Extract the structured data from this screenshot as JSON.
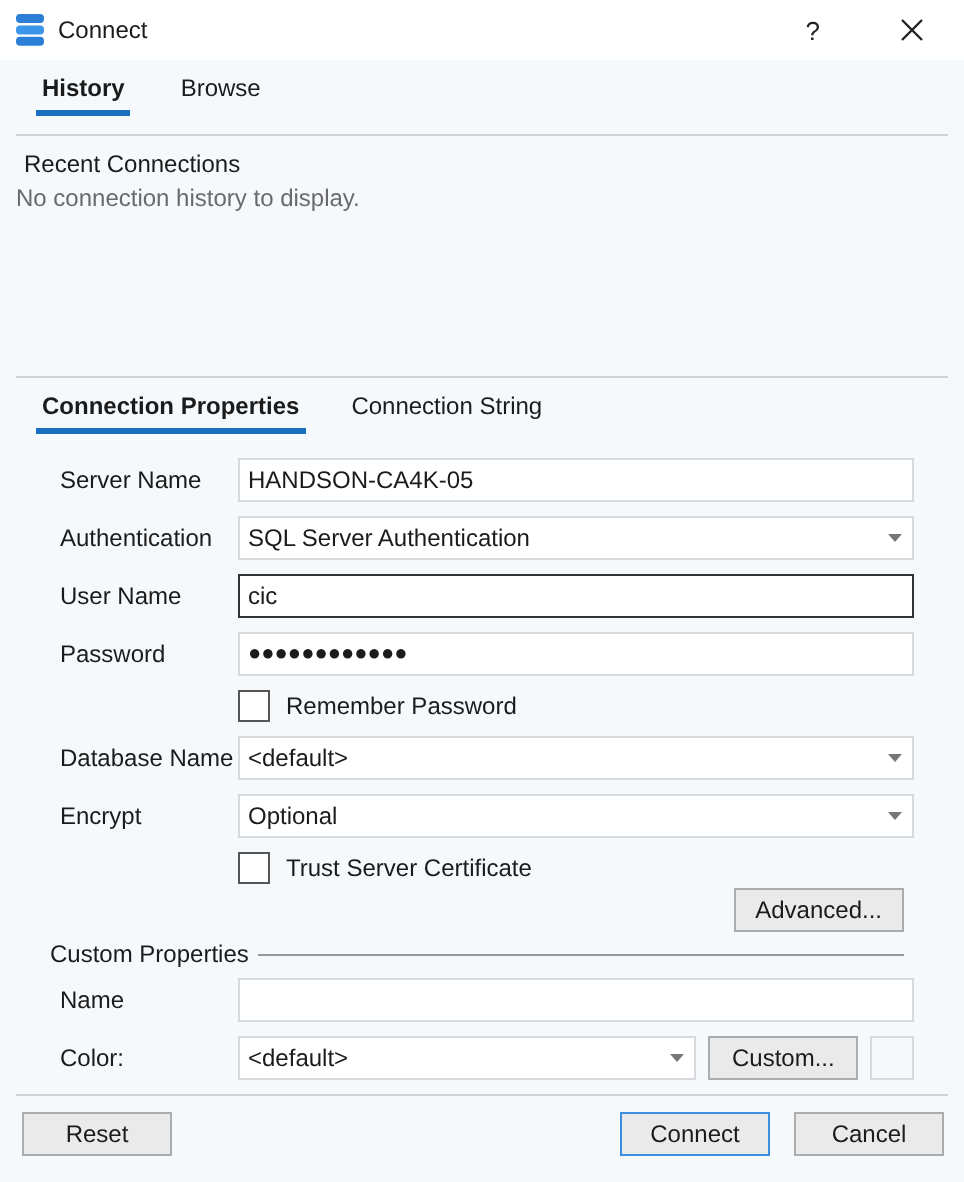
{
  "window": {
    "title": "Connect",
    "help": "?"
  },
  "top_tabs": [
    {
      "label": "History",
      "selected": true
    },
    {
      "label": "Browse",
      "selected": false
    }
  ],
  "recent": {
    "title": "Recent Connections",
    "message": "No connection history to display."
  },
  "property_tabs": [
    {
      "label": "Connection Properties",
      "selected": true
    },
    {
      "label": "Connection String",
      "selected": false
    }
  ],
  "fields": [
    {
      "kind": "text",
      "label": "Server Name",
      "value": "HANDSON-CA4K-05",
      "focused": false
    },
    {
      "kind": "dropdown",
      "label": "Authentication",
      "value": "SQL Server Authentication",
      "focused": false
    },
    {
      "kind": "text",
      "label": "User Name",
      "value": "cic",
      "focused": true
    },
    {
      "kind": "password",
      "label": "Password",
      "value": "●●●●●●●●●●●●",
      "focused": false
    },
    {
      "kind": "checkbox",
      "label": "Remember Password",
      "checked": false
    },
    {
      "kind": "dropdown",
      "label": "Database Name",
      "value": "<default>",
      "focused": false
    },
    {
      "kind": "dropdown",
      "label": "Encrypt",
      "value": "Optional",
      "focused": false
    },
    {
      "kind": "checkbox",
      "label": "Trust Server Certificate",
      "checked": false
    }
  ],
  "advanced_button": "Advanced...",
  "custom_properties": {
    "title": "Custom Properties",
    "name_label": "Name",
    "color_label": "Color:",
    "color_value": "<default>",
    "custom_button": "Custom..."
  },
  "buttons": {
    "reset": "Reset",
    "connect": "Connect",
    "cancel": "Cancel"
  }
}
